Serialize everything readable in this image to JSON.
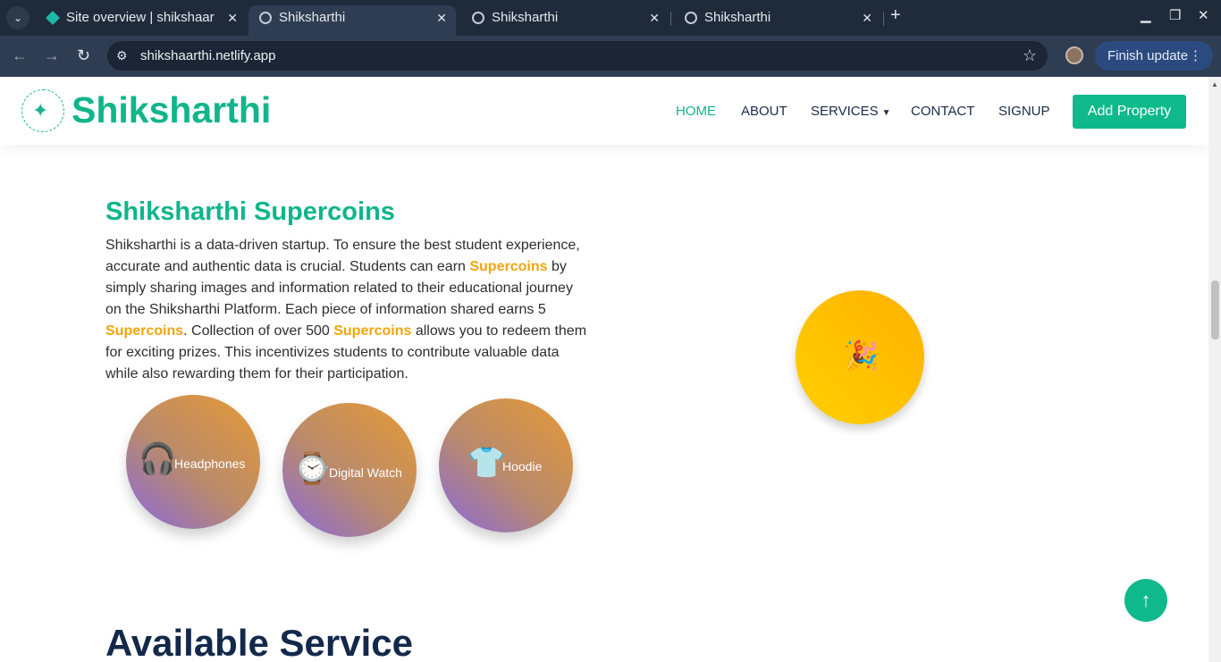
{
  "browser": {
    "tabs": [
      {
        "title": "Site overview | shikshaarthi",
        "icon": "netlify-icon",
        "active": false
      },
      {
        "title": "Shiksharthi",
        "icon": "globe-icon",
        "active": true
      },
      {
        "title": "Shiksharthi",
        "icon": "globe-icon",
        "active": false
      },
      {
        "title": "Shiksharthi",
        "icon": "globe-icon",
        "active": false
      }
    ],
    "url": "shikshaarthi.netlify.app",
    "update_label": "Finish update"
  },
  "site": {
    "brand": "Shiksharthi",
    "nav": {
      "home": "HOME",
      "about": "ABOUT",
      "services": "SERVICES",
      "contact": "CONTACT",
      "signup": "SIGNUP"
    },
    "cta": "Add Property"
  },
  "supercoins": {
    "title": "Shiksharthi Supercoins",
    "p1": "Shiksharthi is a data-driven startup. To ensure the best student experience, accurate and authentic data is crucial. Students can earn ",
    "hl1": "Supercoins",
    "p2": " by simply sharing images and information related to their educational journey on the Shiksharthi Platform. Each piece of information shared earns 5 ",
    "hl2": "Supercoins",
    "p3": ". Collection of over 500 ",
    "hl3": "Supercoins",
    "p4": " allows you to redeem them for exciting prizes. This incentivizes students to contribute valuable data while also rewarding them for their participation.",
    "prizes": [
      {
        "label": "Headphones",
        "icon": "🎧"
      },
      {
        "label": "Digital Watch",
        "icon": "⌚"
      },
      {
        "label": "Hoodie",
        "icon": "👕"
      }
    ],
    "party_icon": "🎉"
  },
  "next_section_title": "Available Service",
  "colors": {
    "brand": "#10b58b",
    "highlight": "#f5a40b",
    "heading": "#13294b"
  }
}
